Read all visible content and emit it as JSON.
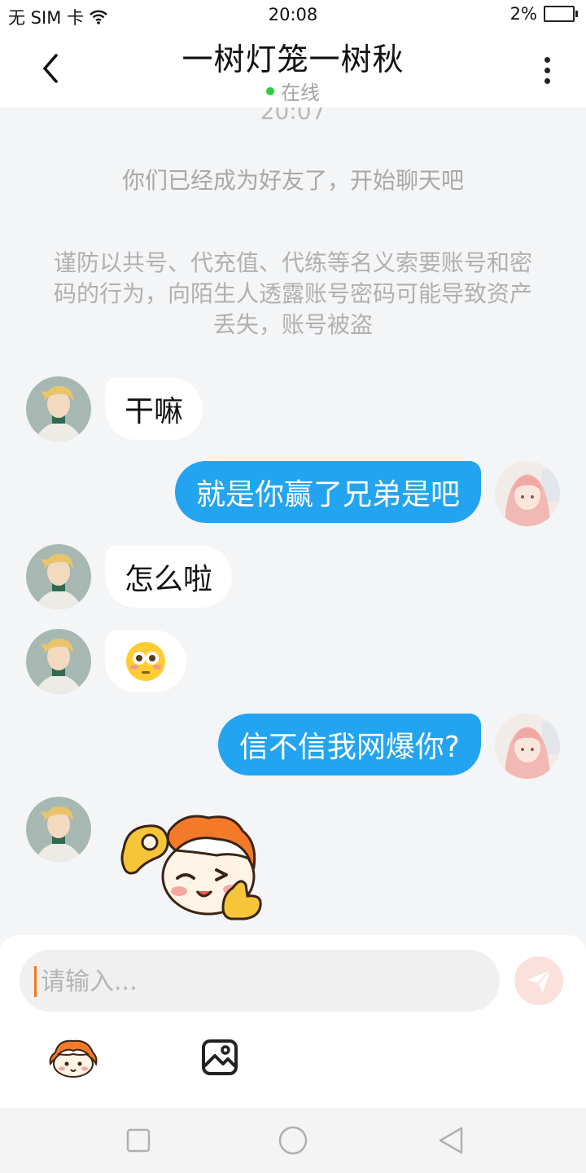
{
  "status_bar": {
    "carrier": "无 SIM 卡",
    "time": "20:08",
    "battery": "2%"
  },
  "header": {
    "title": "一树灯笼一树秋",
    "status": "在线"
  },
  "chat": {
    "timestamp": "20:07",
    "system_message": "你们已经成为好友了，开始聊天吧",
    "warning_message": "谨防以共号、代充值、代练等名义索要账号和密码的行为，向陌生人透露账号密码可能导致资产丢失，账号被盗",
    "messages": [
      {
        "from": "friend",
        "text": "干嘛"
      },
      {
        "from": "me",
        "text": "就是你赢了兄弟是吧"
      },
      {
        "from": "friend",
        "text": "怎么啦"
      },
      {
        "from": "friend",
        "text": "😳"
      },
      {
        "from": "me",
        "text": "信不信我网爆你?"
      },
      {
        "from": "friend",
        "sticker": "orange-mascot-ok-thumbs-up-sticker"
      }
    ]
  },
  "composer": {
    "placeholder": "请输入..."
  },
  "colors": {
    "outgoing_bubble": "#23a4f0",
    "incoming_bubble": "#ffffff",
    "background": "#f4f5f7",
    "online_dot": "#2ecc40",
    "send_button": "#fbe1dc"
  }
}
